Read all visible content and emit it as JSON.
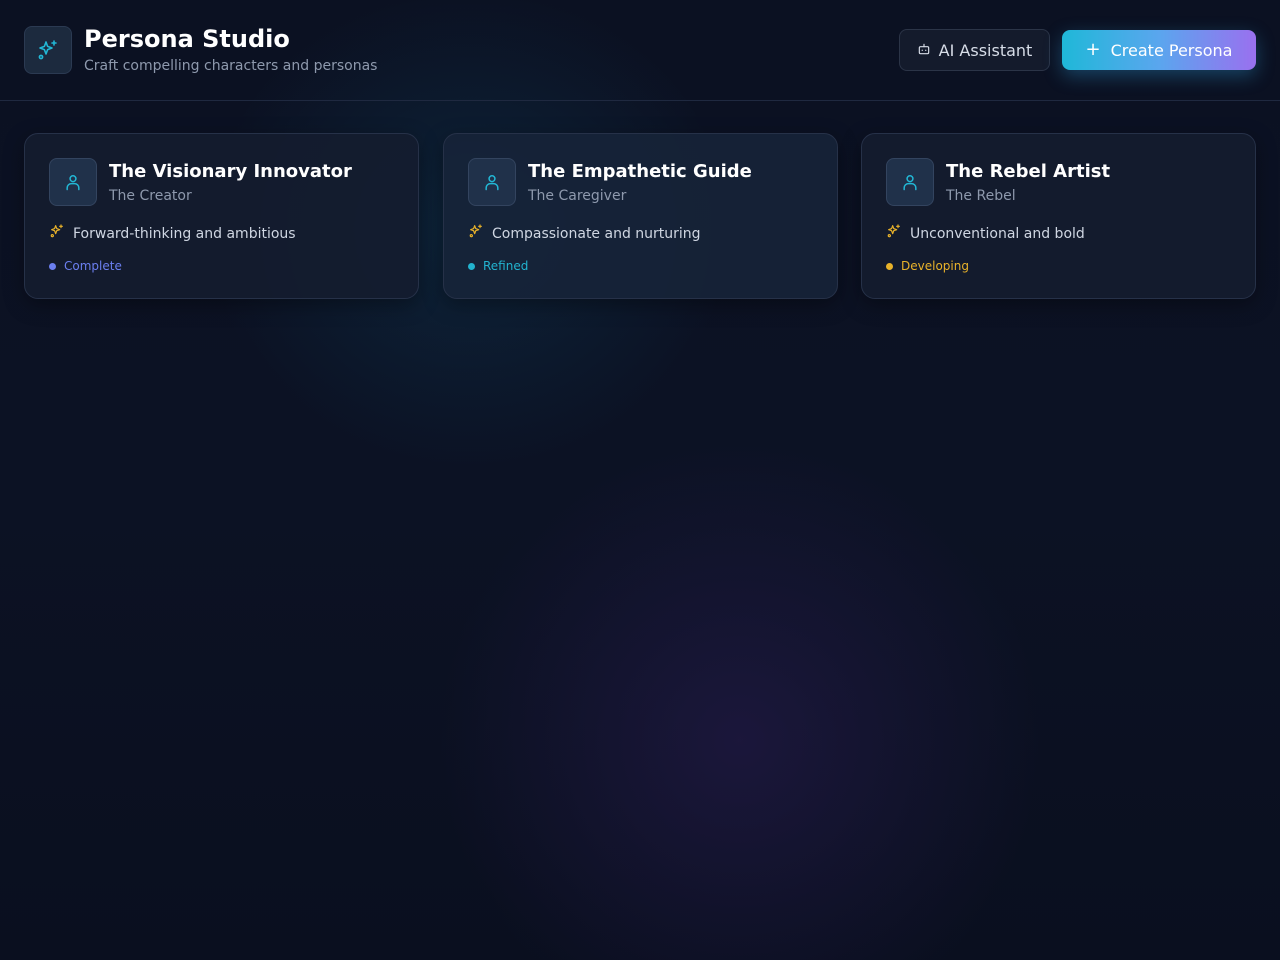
{
  "header": {
    "title": "Persona Studio",
    "subtitle": "Craft compelling characters and personas",
    "logo_icon": "sparkles-icon",
    "ai_button_label": "AI Assistant",
    "ai_button_icon": "bot-icon",
    "create_button_label": "Create Persona",
    "create_button_icon": "plus-icon"
  },
  "personas": [
    {
      "name": "The Visionary Innovator",
      "archetype": "The Creator",
      "trait": "Forward-thinking and ambitious",
      "status": "Complete",
      "status_color": "#6b7ff0",
      "avatar_icon": "user-icon"
    },
    {
      "name": "The Empathetic Guide",
      "archetype": "The Caregiver",
      "trait": "Compassionate and nurturing",
      "status": "Refined",
      "status_color": "#22b3cf",
      "avatar_icon": "user-icon"
    },
    {
      "name": "The Rebel Artist",
      "archetype": "The Rebel",
      "trait": "Unconventional and bold",
      "status": "Developing",
      "status_color": "#e8b22a",
      "avatar_icon": "user-icon"
    }
  ],
  "colors": {
    "accent_cyan": "#22b8d6",
    "accent_purple": "#9a70ef",
    "trait_icon": "#e8b22a"
  }
}
